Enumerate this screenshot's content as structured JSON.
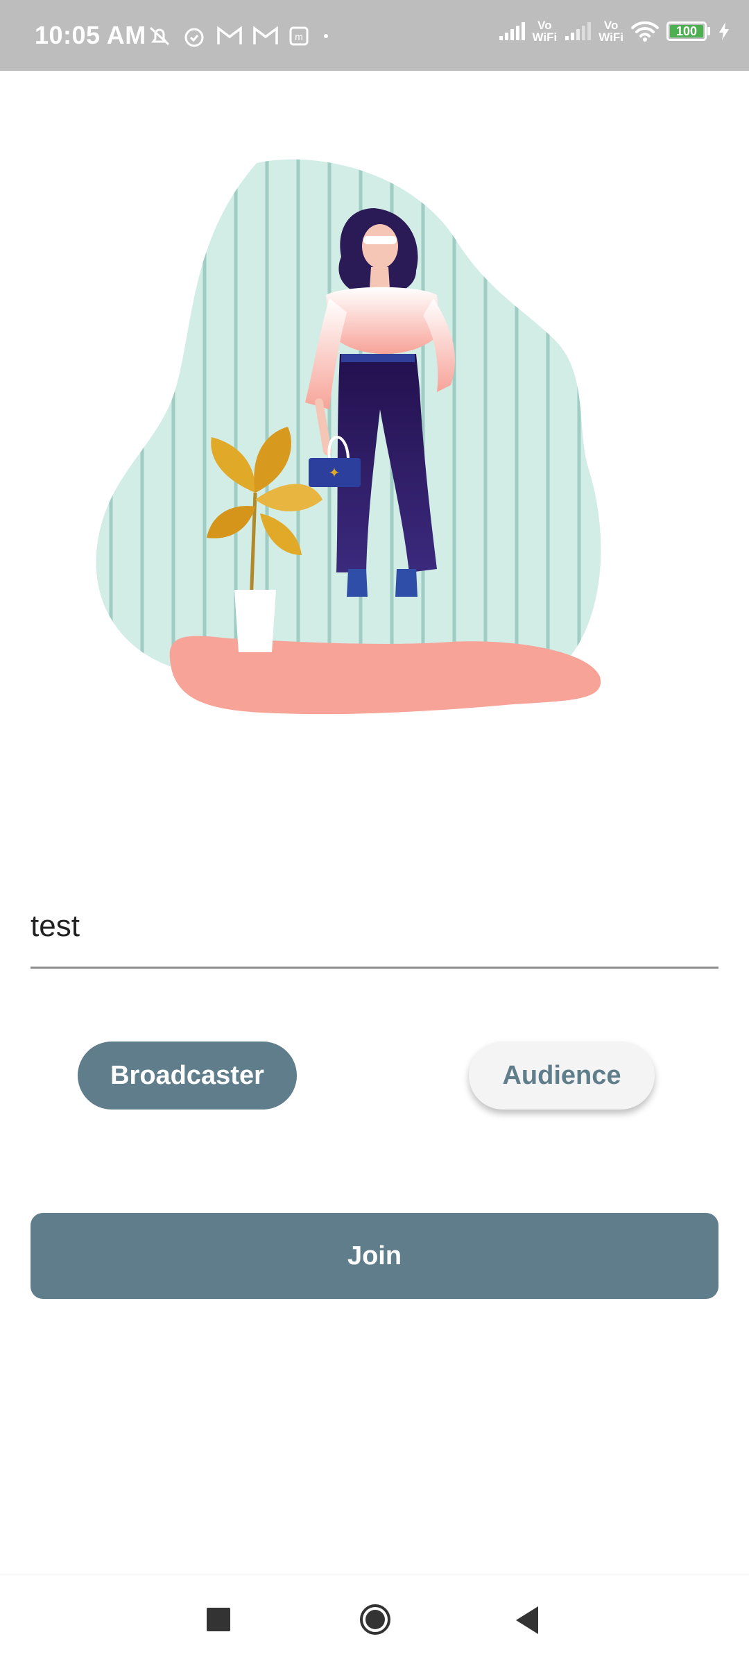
{
  "status_bar": {
    "time": "10:05 AM",
    "icons_left": [
      "muted-notification-icon",
      "alarm-icon",
      "gmail-icon",
      "gmail-icon",
      "m-app-icon",
      "dot-icon"
    ],
    "vowifi_label_top": "Vo",
    "vowifi_label_bottom": "WiFi",
    "battery_level": "100"
  },
  "form": {
    "channel_value": "test",
    "broadcaster_label": "Broadcaster",
    "audience_label": "Audience",
    "join_label": "Join"
  },
  "colors": {
    "primary": "#607d8b",
    "secondary_bg": "#f4f4f4",
    "blob": "#d2ece6",
    "floor": "#f7a398"
  }
}
